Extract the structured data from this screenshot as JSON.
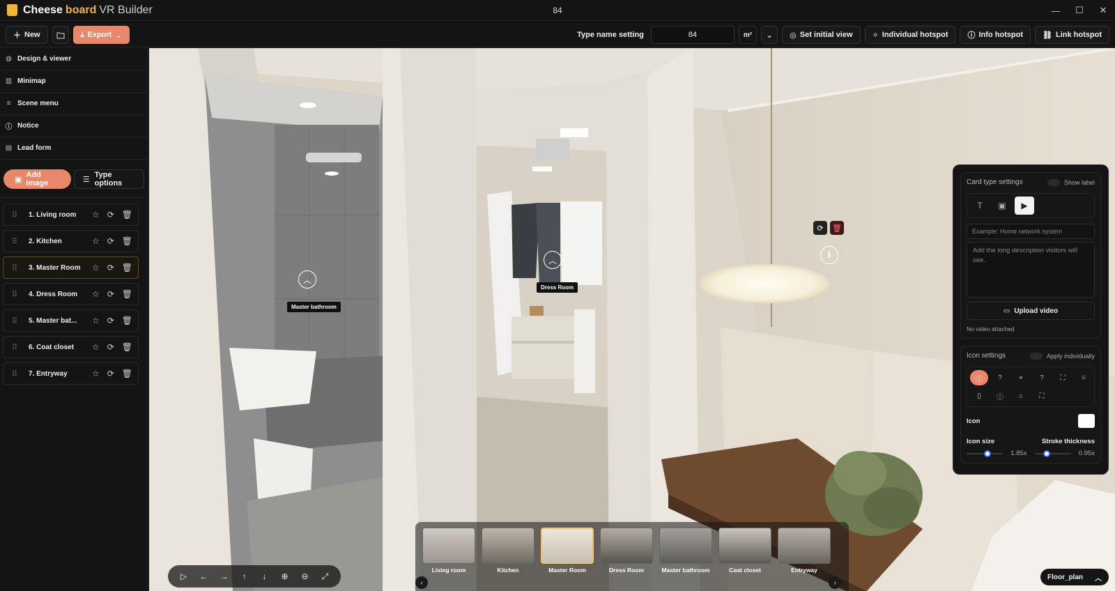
{
  "app": {
    "brand_part1": "Cheese",
    "brand_part2": "board",
    "brand_part3": "VR Builder",
    "window_title": "84"
  },
  "toolbar": {
    "new_label": "New",
    "export_label": "Export",
    "type_name_label": "Type name setting",
    "type_name_value": "84",
    "unit": "m²",
    "set_initial_view": "Set initial view",
    "individual_hotspot": "Individual hotspot",
    "info_hotspot": "Info hotspot",
    "link_hotspot": "Link hotspot"
  },
  "sidebar": {
    "menu": [
      {
        "label": "Design & viewer",
        "icon": "palette-icon"
      },
      {
        "label": "Minimap",
        "icon": "map-icon"
      },
      {
        "label": "Scene menu",
        "icon": "list-icon"
      },
      {
        "label": "Notice",
        "icon": "info-icon"
      },
      {
        "label": "Lead form",
        "icon": "form-icon"
      }
    ],
    "add_image": "Add image",
    "type_options": "Type options",
    "scenes": [
      {
        "name": "1. Living room"
      },
      {
        "name": "2. Kitchen"
      },
      {
        "name": "3. Master Room"
      },
      {
        "name": "4. Dress Room"
      },
      {
        "name": "5. Master bat..."
      },
      {
        "name": "6. Coat closet"
      },
      {
        "name": "7. Entryway"
      }
    ],
    "active_scene_index": 2
  },
  "viewer": {
    "hotspot_master_bathroom": "Master bathroom",
    "hotspot_dress_room": "Dress Room"
  },
  "panel": {
    "card_type_title": "Card type settings",
    "show_label": "Show label",
    "title_placeholder": "Example: Home network system",
    "description_placeholder": "Add the long description visitors will see.",
    "upload_video": "Upload video",
    "no_video": "No video attached",
    "icon_settings": "Icon settings",
    "apply_individually": "Apply individually",
    "icon_label": "Icon",
    "icon_color": "#ffffff",
    "icon_size_label": "Icon size",
    "icon_size_value": "1.85x",
    "icon_size_level": 0.6,
    "stroke_label": "Stroke thickness",
    "stroke_value": "0.95x",
    "stroke_level": 0.3
  },
  "thumbnails": [
    {
      "label": "Living room"
    },
    {
      "label": "Kitchen"
    },
    {
      "label": "Master Room",
      "active": true
    },
    {
      "label": "Dress Room"
    },
    {
      "label": "Master bathroom"
    },
    {
      "label": "Coat closet"
    },
    {
      "label": "Entryway"
    }
  ],
  "floor_plan": "Floor_plan",
  "colors": {
    "accent": "#e9876a",
    "brand": "#f0b63a"
  }
}
